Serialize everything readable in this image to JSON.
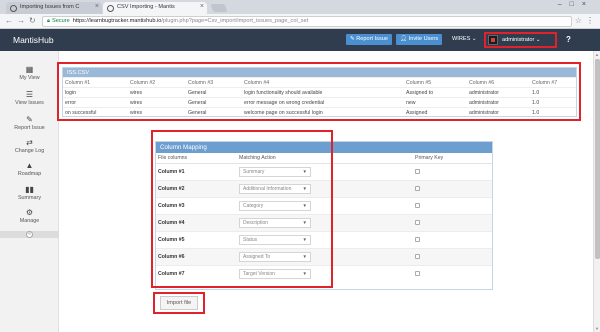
{
  "browser": {
    "tabs": [
      {
        "label": "Importing Issues from C"
      },
      {
        "label": "CSV Importing - Mantis"
      }
    ],
    "secure_label": "Secure",
    "url_host": "https://learnbugtracker.mantishub.io",
    "url_path": "/plugin.php?page=Csv_import/import_issues_page_col_set"
  },
  "navbar": {
    "brand": "MantisHub",
    "report_issue": "Report Issue",
    "invite_users": "Invite Users",
    "project": "WIRES ⌄",
    "user": "administrator ⌄",
    "help": "?"
  },
  "sidebar": {
    "items": [
      {
        "label": "My View",
        "icon": "dashboard-icon"
      },
      {
        "label": "View Issues",
        "icon": "list-icon"
      },
      {
        "label": "Report Issue",
        "icon": "edit-icon"
      },
      {
        "label": "Change Log",
        "icon": "retweet-icon"
      },
      {
        "label": "Roadmap",
        "icon": "road-icon"
      },
      {
        "label": "Summary",
        "icon": "bar-chart-icon"
      },
      {
        "label": "Manage",
        "icon": "gears-icon"
      }
    ]
  },
  "csv": {
    "title": "ISS.CSV",
    "headers": [
      "Column #1",
      "Column #2",
      "Column #3",
      "Column #4",
      "Column #5",
      "Column #6",
      "Column #7"
    ],
    "rows": [
      [
        "login",
        "wires",
        "General",
        "login functionality should available",
        "Assigned to",
        "administrator",
        "1.0"
      ],
      [
        "error",
        "wires",
        "General",
        "error message on wrong credential",
        "new",
        "administrator",
        "1.0"
      ],
      [
        "on successful",
        "wires",
        "General",
        "welcome page on successful login",
        "Assigned",
        "administrator",
        "1.0"
      ]
    ]
  },
  "mapping": {
    "title": "Column Mapping",
    "headers": [
      "File columns",
      "Matching Action",
      "Primary Key"
    ],
    "rows": [
      {
        "column": "Column #1",
        "action": "Summary"
      },
      {
        "column": "Column #2",
        "action": "Additional Information"
      },
      {
        "column": "Column #3",
        "action": "Category"
      },
      {
        "column": "Column #4",
        "action": "Description"
      },
      {
        "column": "Column #5",
        "action": "Status"
      },
      {
        "column": "Column #6",
        "action": "Assigned To"
      },
      {
        "column": "Column #7",
        "action": "Target Version"
      }
    ]
  },
  "import_button": "Import file",
  "colors": {
    "navbar": "#2f3d4e",
    "accent": "#4a8fcf",
    "highlight": "#e0232a",
    "panel_header": "#6c9fd0"
  }
}
